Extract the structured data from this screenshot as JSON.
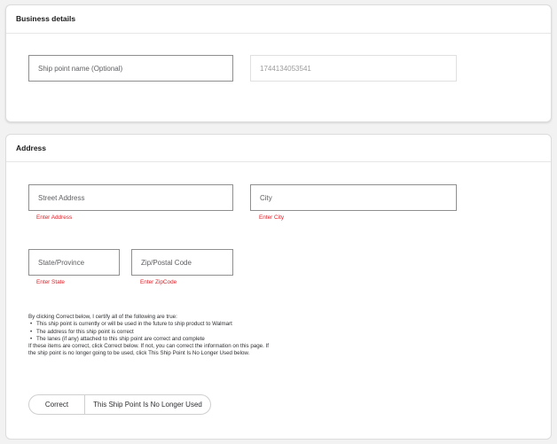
{
  "business_details": {
    "title": "Business details",
    "ship_point_name_placeholder": "Ship point name (Optional)",
    "ship_point_id": "1744134053541"
  },
  "address": {
    "title": "Address",
    "street": {
      "placeholder": "Street Address",
      "error": "Enter Address"
    },
    "city": {
      "placeholder": "City",
      "error": "Enter City"
    },
    "state": {
      "placeholder": "State/Province",
      "error": "Enter State"
    },
    "zip": {
      "placeholder": "Zip/Postal Code",
      "error": "Enter ZipCode"
    }
  },
  "certification": {
    "intro": "By clicking Correct below, I certify all of the following are true:",
    "items": [
      "This ship point is currently or will be used in the future to ship product to Walmart",
      "The address for this ship point is correct",
      "The lanes (if any) attached to this ship point are correct and complete"
    ],
    "outro": "If these items are correct, click Correct below. If not, you can correct the information on this page. If the ship point is no longer going to be used, click This Ship Point Is No Longer Used below."
  },
  "actions": {
    "correct_label": "Correct",
    "no_longer_used_label": "This Ship Point Is No Longer Used"
  },
  "colors": {
    "error": "#de1c24",
    "background": "#f2f2f2",
    "card": "#ffffff"
  }
}
